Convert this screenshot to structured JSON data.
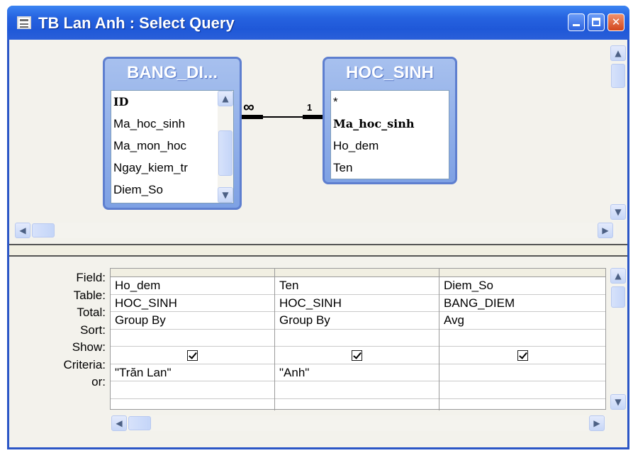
{
  "window": {
    "title": "TB Lan Anh : Select Query"
  },
  "tables": [
    {
      "title": "BANG_DI...",
      "fields": [
        "ID",
        "Ma_hoc_sinh",
        "Ma_mon_hoc",
        "Ngay_kiem_tr",
        "Diem_So"
      ],
      "bold_fields": [
        "ID"
      ]
    },
    {
      "title": "HOC_SINH",
      "fields": [
        "*",
        "Ma_hoc_sinh",
        "Ho_dem",
        "Ten"
      ],
      "bold_fields": [
        "Ma_hoc_sinh"
      ]
    }
  ],
  "relationship": {
    "many_label": "∞",
    "one_label": "1"
  },
  "grid": {
    "row_labels": [
      "Field:",
      "Table:",
      "Total:",
      "Sort:",
      "Show:",
      "Criteria:",
      "or:"
    ],
    "columns": [
      {
        "field": "Ho_dem",
        "table": "HOC_SINH",
        "total": "Group By",
        "sort": "",
        "show": true,
        "criteria": "\"Trăn Lan\"",
        "or": ""
      },
      {
        "field": "Ten",
        "table": "HOC_SINH",
        "total": "Group By",
        "sort": "",
        "show": true,
        "criteria": "\"Anh\"",
        "or": ""
      },
      {
        "field": "Diem_So",
        "table": "BANG_DIEM",
        "total": "Avg",
        "sort": "",
        "show": true,
        "criteria": "",
        "or": ""
      }
    ]
  },
  "icons": {
    "window_icon": "query-icon",
    "minimize": "minimize-icon",
    "maximize": "maximize-icon",
    "close": "close-icon",
    "scroll_up": "scroll-up-arrow-icon",
    "scroll_down": "scroll-down-arrow-icon",
    "scroll_left": "scroll-left-arrow-icon",
    "scroll_right": "scroll-right-arrow-icon"
  },
  "colors": {
    "titlebar": "#2663e0",
    "table_header": "#7ea1e4",
    "close_button": "#d2461c"
  }
}
